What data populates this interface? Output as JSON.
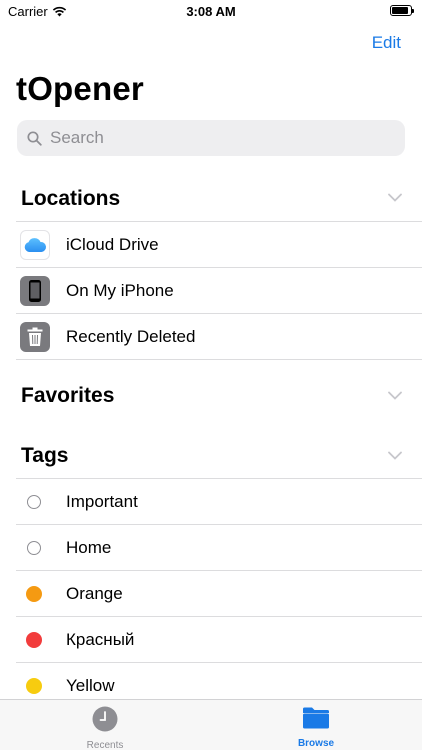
{
  "status": {
    "carrier": "Carrier",
    "time": "3:08 AM"
  },
  "nav": {
    "edit_label": "Edit"
  },
  "app": {
    "title": "tOpener"
  },
  "search": {
    "placeholder": "Search"
  },
  "sections": {
    "locations": {
      "label": "Locations",
      "items": [
        {
          "label": "iCloud Drive",
          "icon": "icloud-icon"
        },
        {
          "label": "On My iPhone",
          "icon": "iphone-icon"
        },
        {
          "label": "Recently Deleted",
          "icon": "trash-icon"
        }
      ]
    },
    "favorites": {
      "label": "Favorites"
    },
    "tags": {
      "label": "Tags",
      "items": [
        {
          "label": "Important",
          "color": "#ffffff"
        },
        {
          "label": "Home",
          "color": "#ffffff"
        },
        {
          "label": "Orange",
          "color": "#f59a12"
        },
        {
          "label": "Красный",
          "color": "#f23c3c"
        },
        {
          "label": "Yellow",
          "color": "#f7cc0f"
        }
      ]
    }
  },
  "tabbar": {
    "recents": {
      "label": "Recents",
      "icon": "clock-icon"
    },
    "browse": {
      "label": "Browse",
      "icon": "folder-icon",
      "selected": true
    }
  },
  "colors": {
    "accent": "#1a7ae6",
    "inactive": "#8e8e93"
  }
}
